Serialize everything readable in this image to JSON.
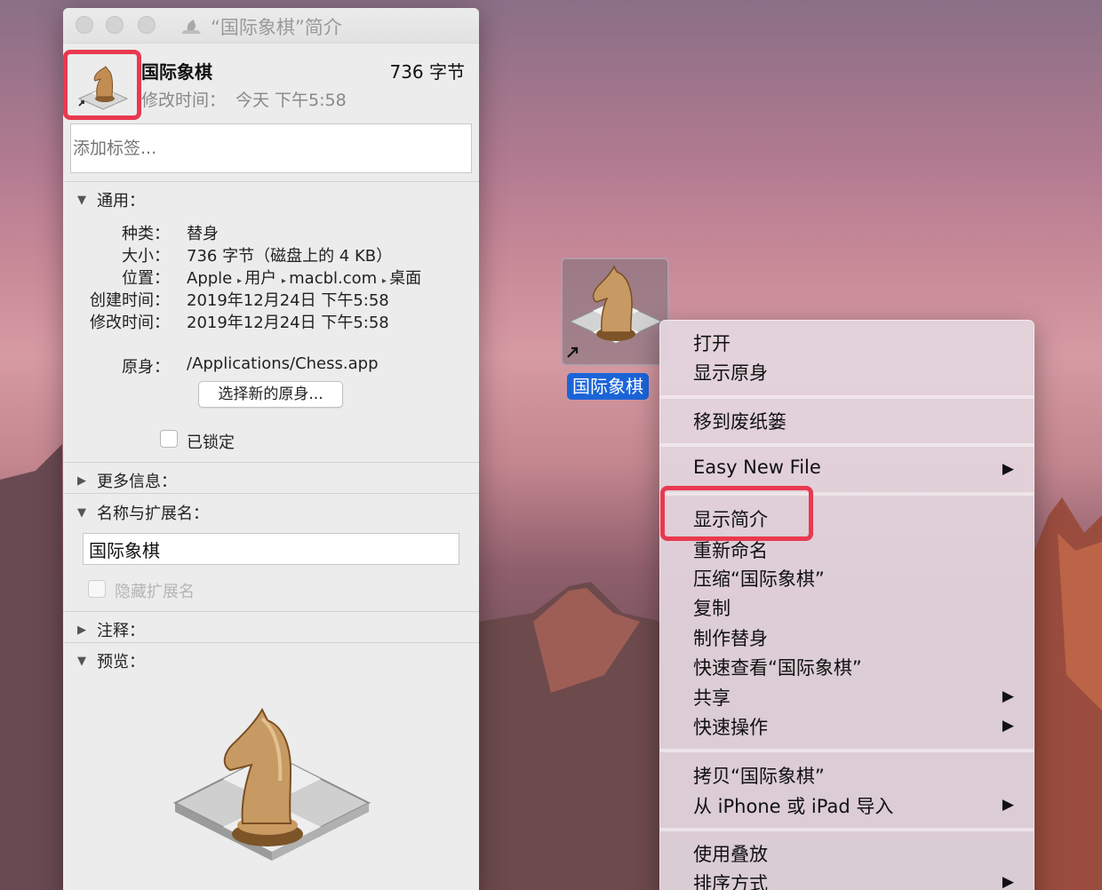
{
  "colors": {
    "highlight": "#e8394f",
    "selection": "#1b64d8"
  },
  "info_window": {
    "title": "“国际象棋”简介",
    "title_icon": "chess-alias-icon",
    "file_name": "国际象棋",
    "file_size": "736 字节",
    "modified_label": "修改时间：",
    "modified_value": "今天 下午5:58",
    "tags_placeholder": "添加标签...",
    "general": {
      "header": "通用：",
      "rows": [
        {
          "label": "种类：",
          "value": "替身"
        },
        {
          "label": "大小：",
          "value": "736 字节（磁盘上的 4 KB）"
        },
        {
          "label": "创建时间：",
          "value": "2019年12月24日 下午5:58"
        },
        {
          "label": "修改时间：",
          "value": "2019年12月24日 下午5:58"
        }
      ],
      "location_label": "位置：",
      "location_parts": [
        "Apple",
        "用户",
        "macbl.com",
        "桌面"
      ],
      "original_label": "原身：",
      "original_value": "/Applications/Chess.app",
      "select_button": "选择新的原身...",
      "locked_label": "已锁定"
    },
    "more_info_header": "更多信息：",
    "name_ext": {
      "header": "名称与扩展名：",
      "value": "国际象棋",
      "hide_ext_label": "隐藏扩展名"
    },
    "comments_header": "注释：",
    "preview_header": "预览："
  },
  "desktop_icon": {
    "label": "国际象棋"
  },
  "context_menu": {
    "groups": [
      [
        "打开",
        "显示原身"
      ],
      [
        "移到废纸篓"
      ],
      [
        "Easy New File"
      ],
      [
        "显示简介",
        "重新命名",
        "压缩“国际象棋”",
        "复制",
        "制作替身",
        "快速查看“国际象棋”",
        "共享",
        "快速操作"
      ],
      [
        "拷贝“国际象棋”",
        "从 iPhone 或 iPad 导入"
      ],
      [
        "使用叠放",
        "排序方式"
      ]
    ],
    "submenu_arrow": "▶"
  }
}
